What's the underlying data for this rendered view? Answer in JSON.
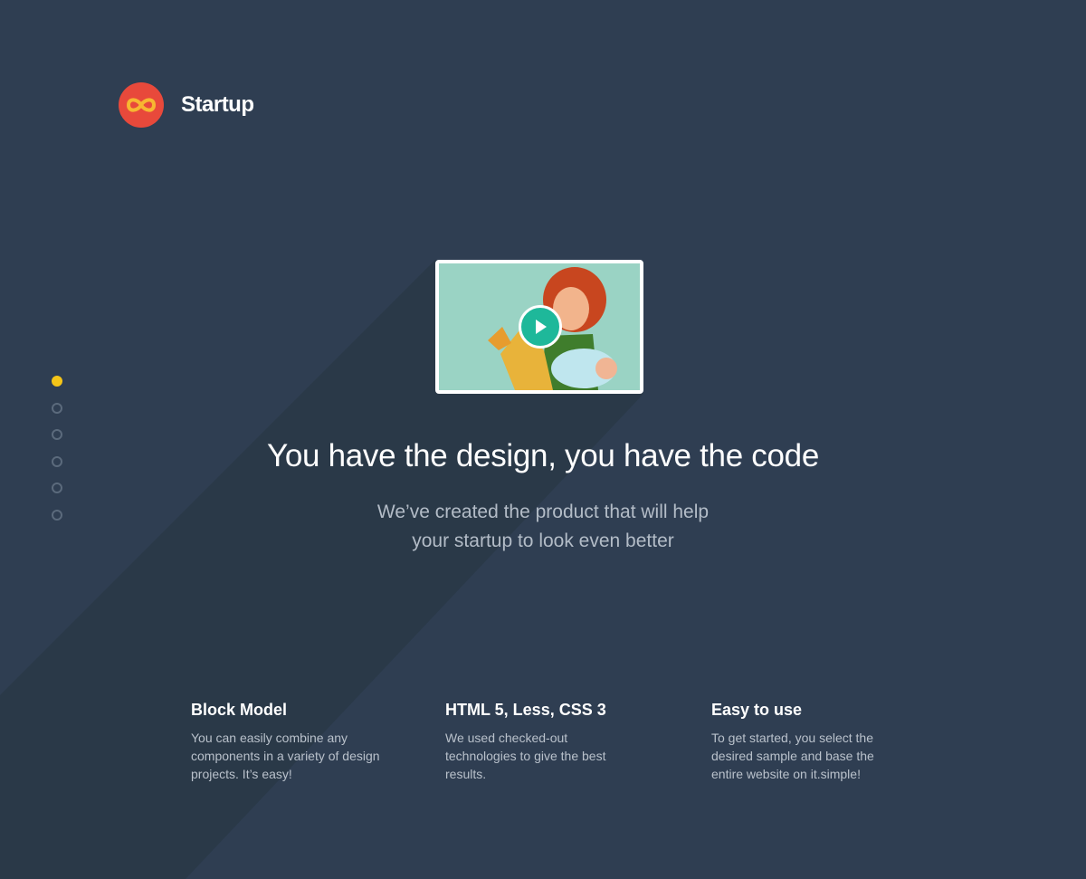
{
  "brand": {
    "name": "Startup",
    "logo_icon": "infinity-icon",
    "logo_color": "#e8493b"
  },
  "nav_dots": {
    "count": 6,
    "active_index": 0,
    "active_color": "#f5c518"
  },
  "video": {
    "play_icon": "play-icon",
    "accent": "#1eb89a"
  },
  "hero": {
    "headline": "You have the design, you have the code",
    "subline_1": "We’ve created the product that will help",
    "subline_2": "your startup to look even better"
  },
  "features": [
    {
      "title": "Block Model",
      "line_1": "You can easily combine any",
      "line_2": "components in a variety of design",
      "line_3": "projects. It’s easy!"
    },
    {
      "title": "HTML 5, Less, CSS 3",
      "line_1": "We used checked-out",
      "line_2": "technologies to give the best",
      "line_3": "results."
    },
    {
      "title": "Easy to use",
      "line_1": "To get started, you select the",
      "line_2": "desired sample and base the",
      "line_3": "entire website on it.simple!"
    }
  ]
}
